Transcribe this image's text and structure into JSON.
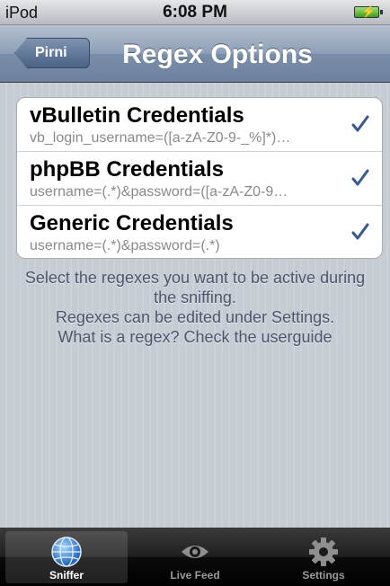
{
  "status_bar": {
    "carrier": "iPod",
    "time": "6:08 PM"
  },
  "nav": {
    "back_label": "Pirni",
    "title": "Regex Options"
  },
  "regex_list": [
    {
      "title": "vBulletin Credentials",
      "subtitle": "vb_login_username=([a-zA-Z0-9-_%]*)…",
      "checked": true
    },
    {
      "title": "phpBB Credentials",
      "subtitle": "username=(.*)&password=([a-zA-Z0-9…",
      "checked": true
    },
    {
      "title": "Generic Credentials",
      "subtitle": "username=(.*)&password=(.*)",
      "checked": true
    }
  ],
  "footer": {
    "line1": "Select the regexes you want to be active during",
    "line2": "the sniffing.",
    "line3": "Regexes can be edited under Settings.",
    "line4": "What is a regex? Check the userguide"
  },
  "tabs": [
    {
      "label": "Sniffer",
      "icon": "globe-icon",
      "active": true
    },
    {
      "label": "Live Feed",
      "icon": "eye-icon",
      "active": false
    },
    {
      "label": "Settings",
      "icon": "gear-icon",
      "active": false
    }
  ],
  "colors": {
    "check": "#395a8f",
    "navbar": "#7a8ea9",
    "background": "#c5ccd4"
  }
}
